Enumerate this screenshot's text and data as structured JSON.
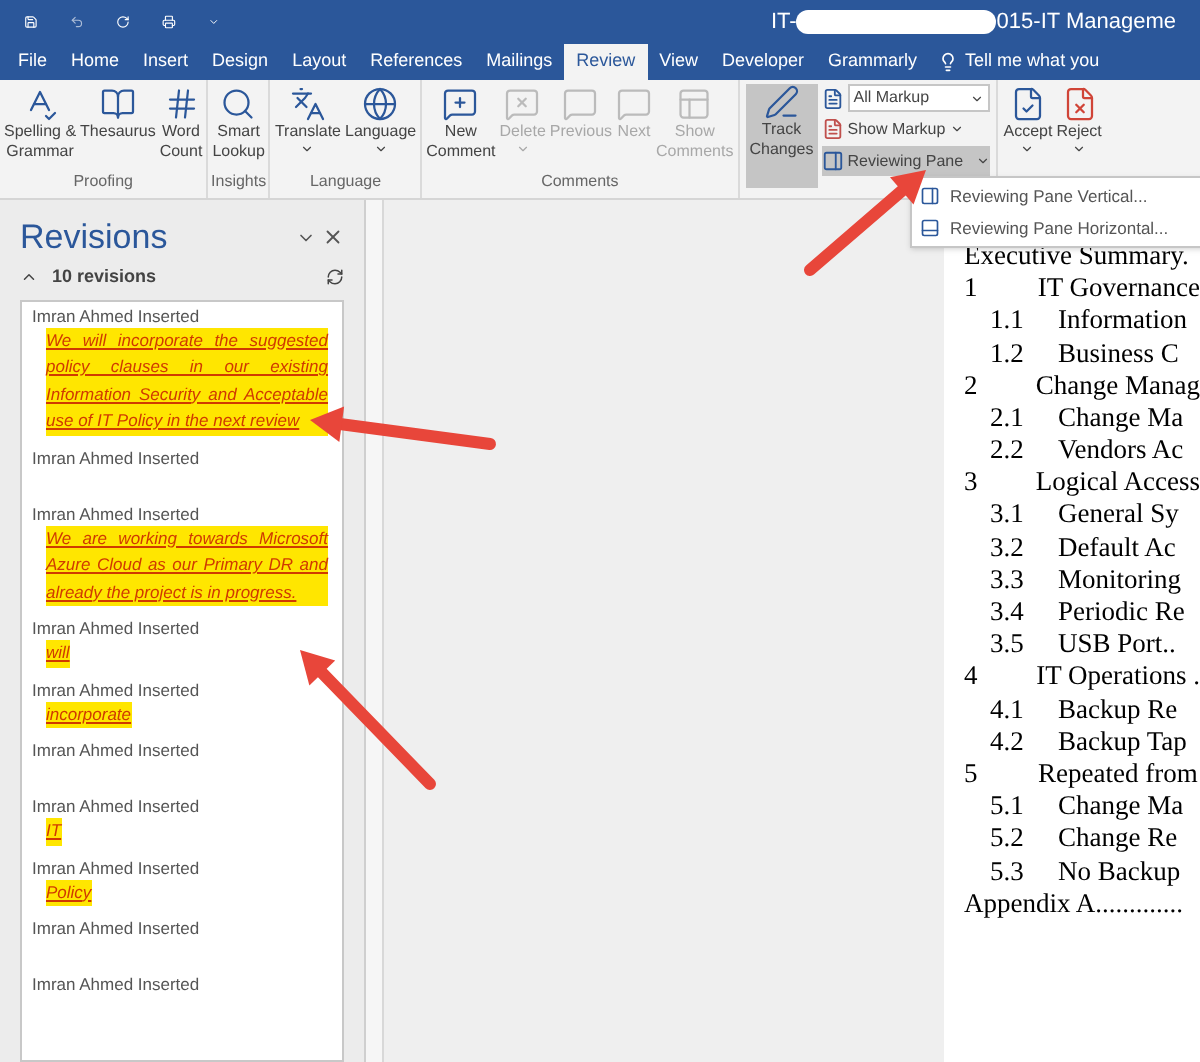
{
  "window": {
    "title_start": "IT-",
    "title_end": "015-IT Manageme"
  },
  "tabs": [
    {
      "label": "File",
      "selected": false
    },
    {
      "label": "Home",
      "selected": false
    },
    {
      "label": "Insert",
      "selected": false
    },
    {
      "label": "Design",
      "selected": false
    },
    {
      "label": "Layout",
      "selected": false
    },
    {
      "label": "References",
      "selected": false
    },
    {
      "label": "Mailings",
      "selected": false
    },
    {
      "label": "Review",
      "selected": true
    },
    {
      "label": "View",
      "selected": false
    },
    {
      "label": "Developer",
      "selected": false
    },
    {
      "label": "Grammarly",
      "selected": false
    }
  ],
  "tell_me": "Tell me what you",
  "ribbon": [
    {
      "label": "Proofing",
      "items": [
        {
          "lines": [
            "Spelling &",
            "Grammar"
          ],
          "disabled": false,
          "caret": false
        },
        {
          "lines": [
            "Thesaurus"
          ],
          "disabled": false,
          "caret": false
        },
        {
          "lines": [
            "Word",
            "Count"
          ],
          "disabled": false,
          "caret": false
        }
      ]
    },
    {
      "label": "Insights",
      "items": [
        {
          "lines": [
            "Smart",
            "Lookup"
          ],
          "disabled": false,
          "caret": false
        }
      ]
    },
    {
      "label": "Language",
      "items": [
        {
          "lines": [
            "Translate"
          ],
          "disabled": false,
          "caret": true
        },
        {
          "lines": [
            "Language"
          ],
          "disabled": false,
          "caret": true
        }
      ]
    },
    {
      "label": "Comments",
      "items": [
        {
          "lines": [
            "New",
            "Comment"
          ],
          "disabled": false,
          "caret": false
        },
        {
          "lines": [
            "Delete"
          ],
          "disabled": true,
          "caret": true
        },
        {
          "lines": [
            "Previous"
          ],
          "disabled": true,
          "caret": false
        },
        {
          "lines": [
            "Next"
          ],
          "disabled": true,
          "caret": false
        },
        {
          "lines": [
            "Show",
            "Comments"
          ],
          "disabled": true,
          "caret": false
        }
      ]
    }
  ],
  "tracking": {
    "track_changes": {
      "lines": [
        "Track",
        "Changes"
      ],
      "selected": true
    },
    "markup_select": {
      "value": "All Markup"
    },
    "show_markup": {
      "label": "Show Markup"
    },
    "reviewing_pane": {
      "label": "Reviewing Pane",
      "expanded": true
    },
    "menu": [
      {
        "label": "Reviewing Pane Vertical..."
      },
      {
        "label": "Reviewing Pane Horizontal..."
      }
    ]
  },
  "changes": [
    {
      "label": "Accept"
    },
    {
      "label": "Reject"
    }
  ],
  "revisions_pane": {
    "title": "Revisions",
    "count": "10 revisions",
    "expanded": true,
    "entries": [
      {
        "author": "Imran Ahmed Inserted",
        "text": "We will incorporate the suggested policy clauses in our existing Information Security and Acceptable use of IT Policy in the next review"
      },
      {
        "author": "Imran Ahmed Inserted"
      },
      {
        "author": "Imran Ahmed Inserted",
        "text": "We are working towards Microsoft Azure Cloud as our Primary DR and already the project is in progress."
      },
      {
        "author": "Imran Ahmed Inserted",
        "text": "will"
      },
      {
        "author": "Imran Ahmed Inserted",
        "text": "incorporate"
      },
      {
        "author": "Imran Ahmed Inserted"
      },
      {
        "author": "Imran Ahmed Inserted",
        "text": "IT"
      },
      {
        "author": "Imran Ahmed Inserted",
        "text": "Policy"
      },
      {
        "author": "Imran Ahmed Inserted"
      },
      {
        "author": "Imran Ahmed Inserted"
      }
    ]
  },
  "document": {
    "toc": [
      {
        "title": "Executive Summary."
      },
      {
        "number": "1",
        "title": "IT Governance",
        "children": [
          {
            "number": "1.1",
            "title": "Information"
          },
          {
            "number": "1.2",
            "title": "Business C"
          }
        ]
      },
      {
        "number": "2",
        "title": "Change Manag",
        "children": [
          {
            "number": "2.1",
            "title": "Change Ma"
          },
          {
            "number": "2.2",
            "title": "Vendors Ac"
          }
        ]
      },
      {
        "number": "3",
        "title": "Logical Access",
        "children": [
          {
            "number": "3.1",
            "title": "General Sy"
          },
          {
            "number": "3.2",
            "title": "Default Ac"
          },
          {
            "number": "3.3",
            "title": "Monitoring"
          },
          {
            "number": "3.4",
            "title": "Periodic Re"
          },
          {
            "number": "3.5",
            "title": "USB Port.."
          }
        ]
      },
      {
        "number": "4",
        "title": "IT Operations .",
        "children": [
          {
            "number": "4.1",
            "title": "Backup Re"
          },
          {
            "number": "4.2",
            "title": "Backup Tap"
          }
        ]
      },
      {
        "number": "5",
        "title": "Repeated from",
        "children": [
          {
            "number": "5.1",
            "title": "Change Ma"
          },
          {
            "number": "5.2",
            "title": "Change Re"
          },
          {
            "number": "5.3",
            "title": "No Backup"
          }
        ]
      },
      {
        "title": "Appendix A............."
      }
    ]
  }
}
